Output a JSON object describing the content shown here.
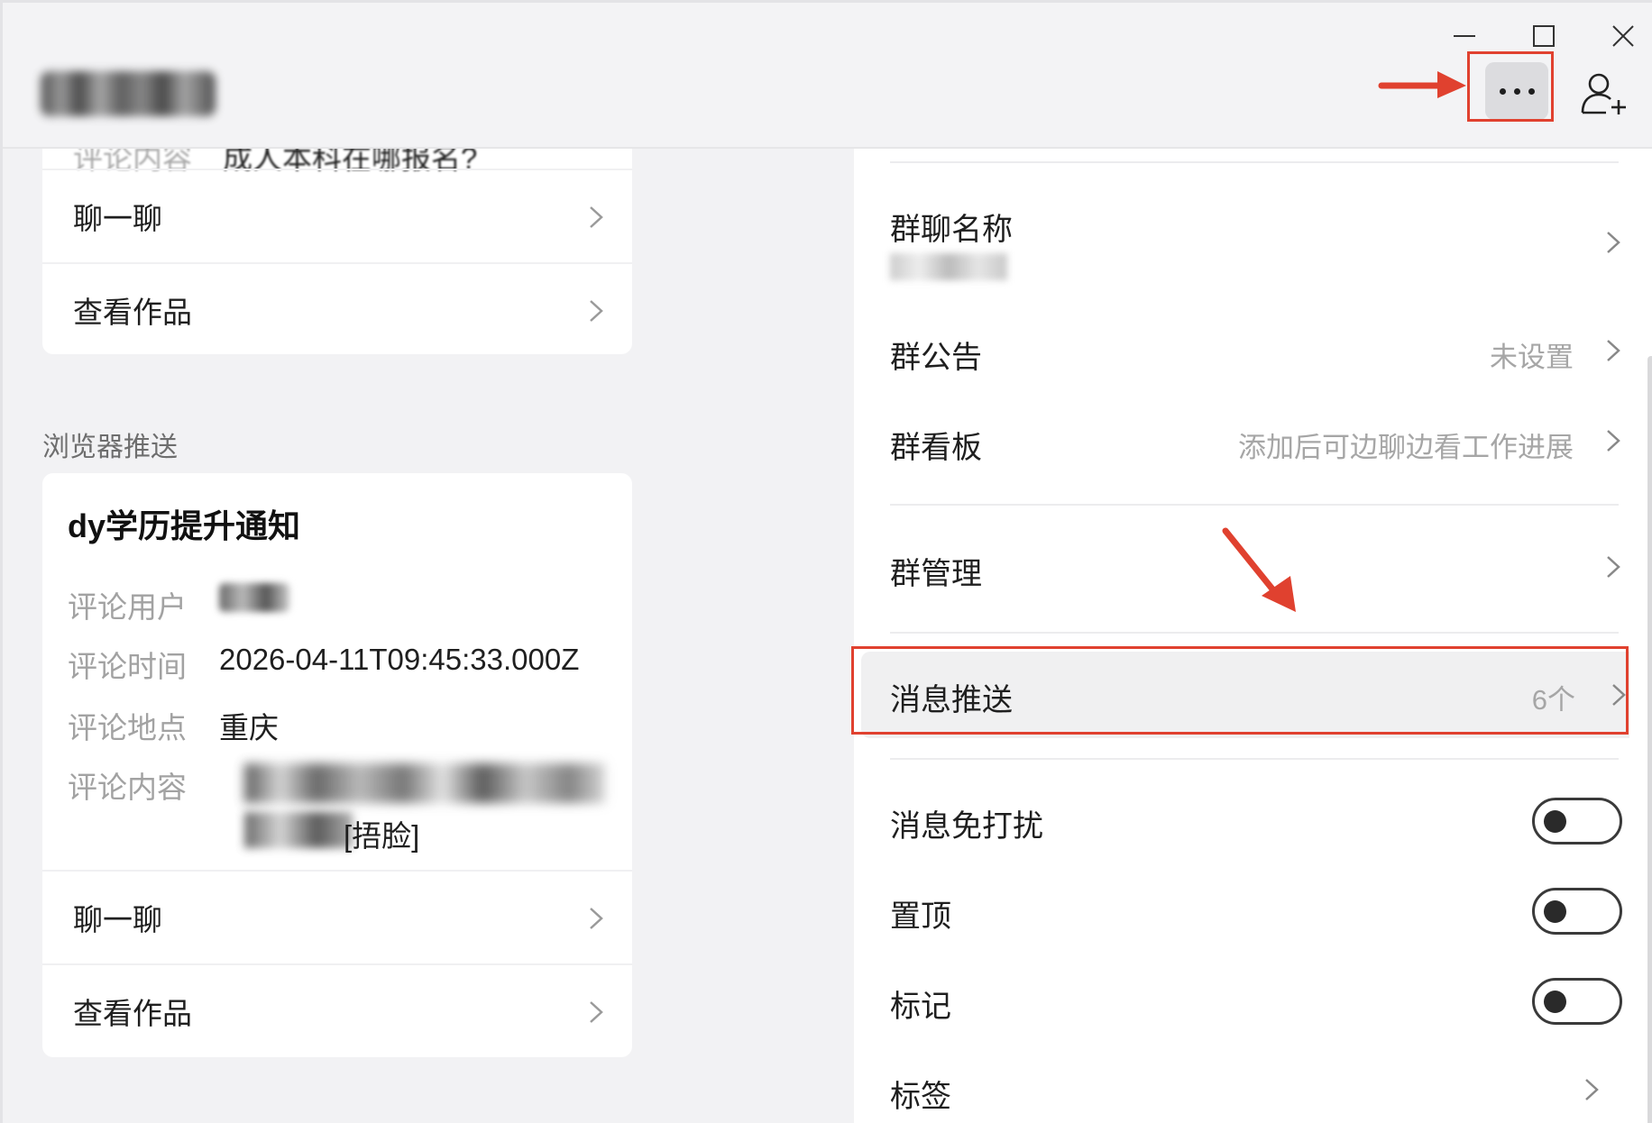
{
  "window": {
    "title": "",
    "controls": {
      "minimize": "minimize-icon",
      "maximize": "maximize-icon",
      "close": "close-icon"
    }
  },
  "toolbar": {
    "more_icon": "more-horizontal-icon",
    "add_member_icon": "add-user-icon"
  },
  "left": {
    "card1": {
      "clipped_key": "评论内容",
      "clipped_value": "成人本科在哪报名?",
      "actions": [
        {
          "label": "聊一聊"
        },
        {
          "label": "查看作品"
        }
      ]
    },
    "section_label": "浏览器推送",
    "card2": {
      "title": "dy学历提升通知",
      "fields": [
        {
          "key": "评论用户",
          "value": ""
        },
        {
          "key": "评论时间",
          "value": "2026-04-11T09:45:33.000Z"
        },
        {
          "key": "评论地点",
          "value": "重庆"
        },
        {
          "key": "评论内容",
          "value": ""
        }
      ],
      "content_tail": "[捂脸]",
      "actions": [
        {
          "label": "聊一聊"
        },
        {
          "label": "查看作品"
        }
      ]
    }
  },
  "settings": {
    "group_name": {
      "label": "群聊名称",
      "value": ""
    },
    "announcement": {
      "label": "群公告",
      "value": "未设置"
    },
    "board": {
      "label": "群看板",
      "value": "添加后可边聊边看工作进展"
    },
    "manage": {
      "label": "群管理"
    },
    "push": {
      "label": "消息推送",
      "value": "6个"
    },
    "dnd": {
      "label": "消息免打扰",
      "on": false
    },
    "pin": {
      "label": "置顶",
      "on": false
    },
    "mark": {
      "label": "标记",
      "on": false
    },
    "tags": {
      "label": "标签"
    }
  },
  "annotation_color": "#e0412f"
}
